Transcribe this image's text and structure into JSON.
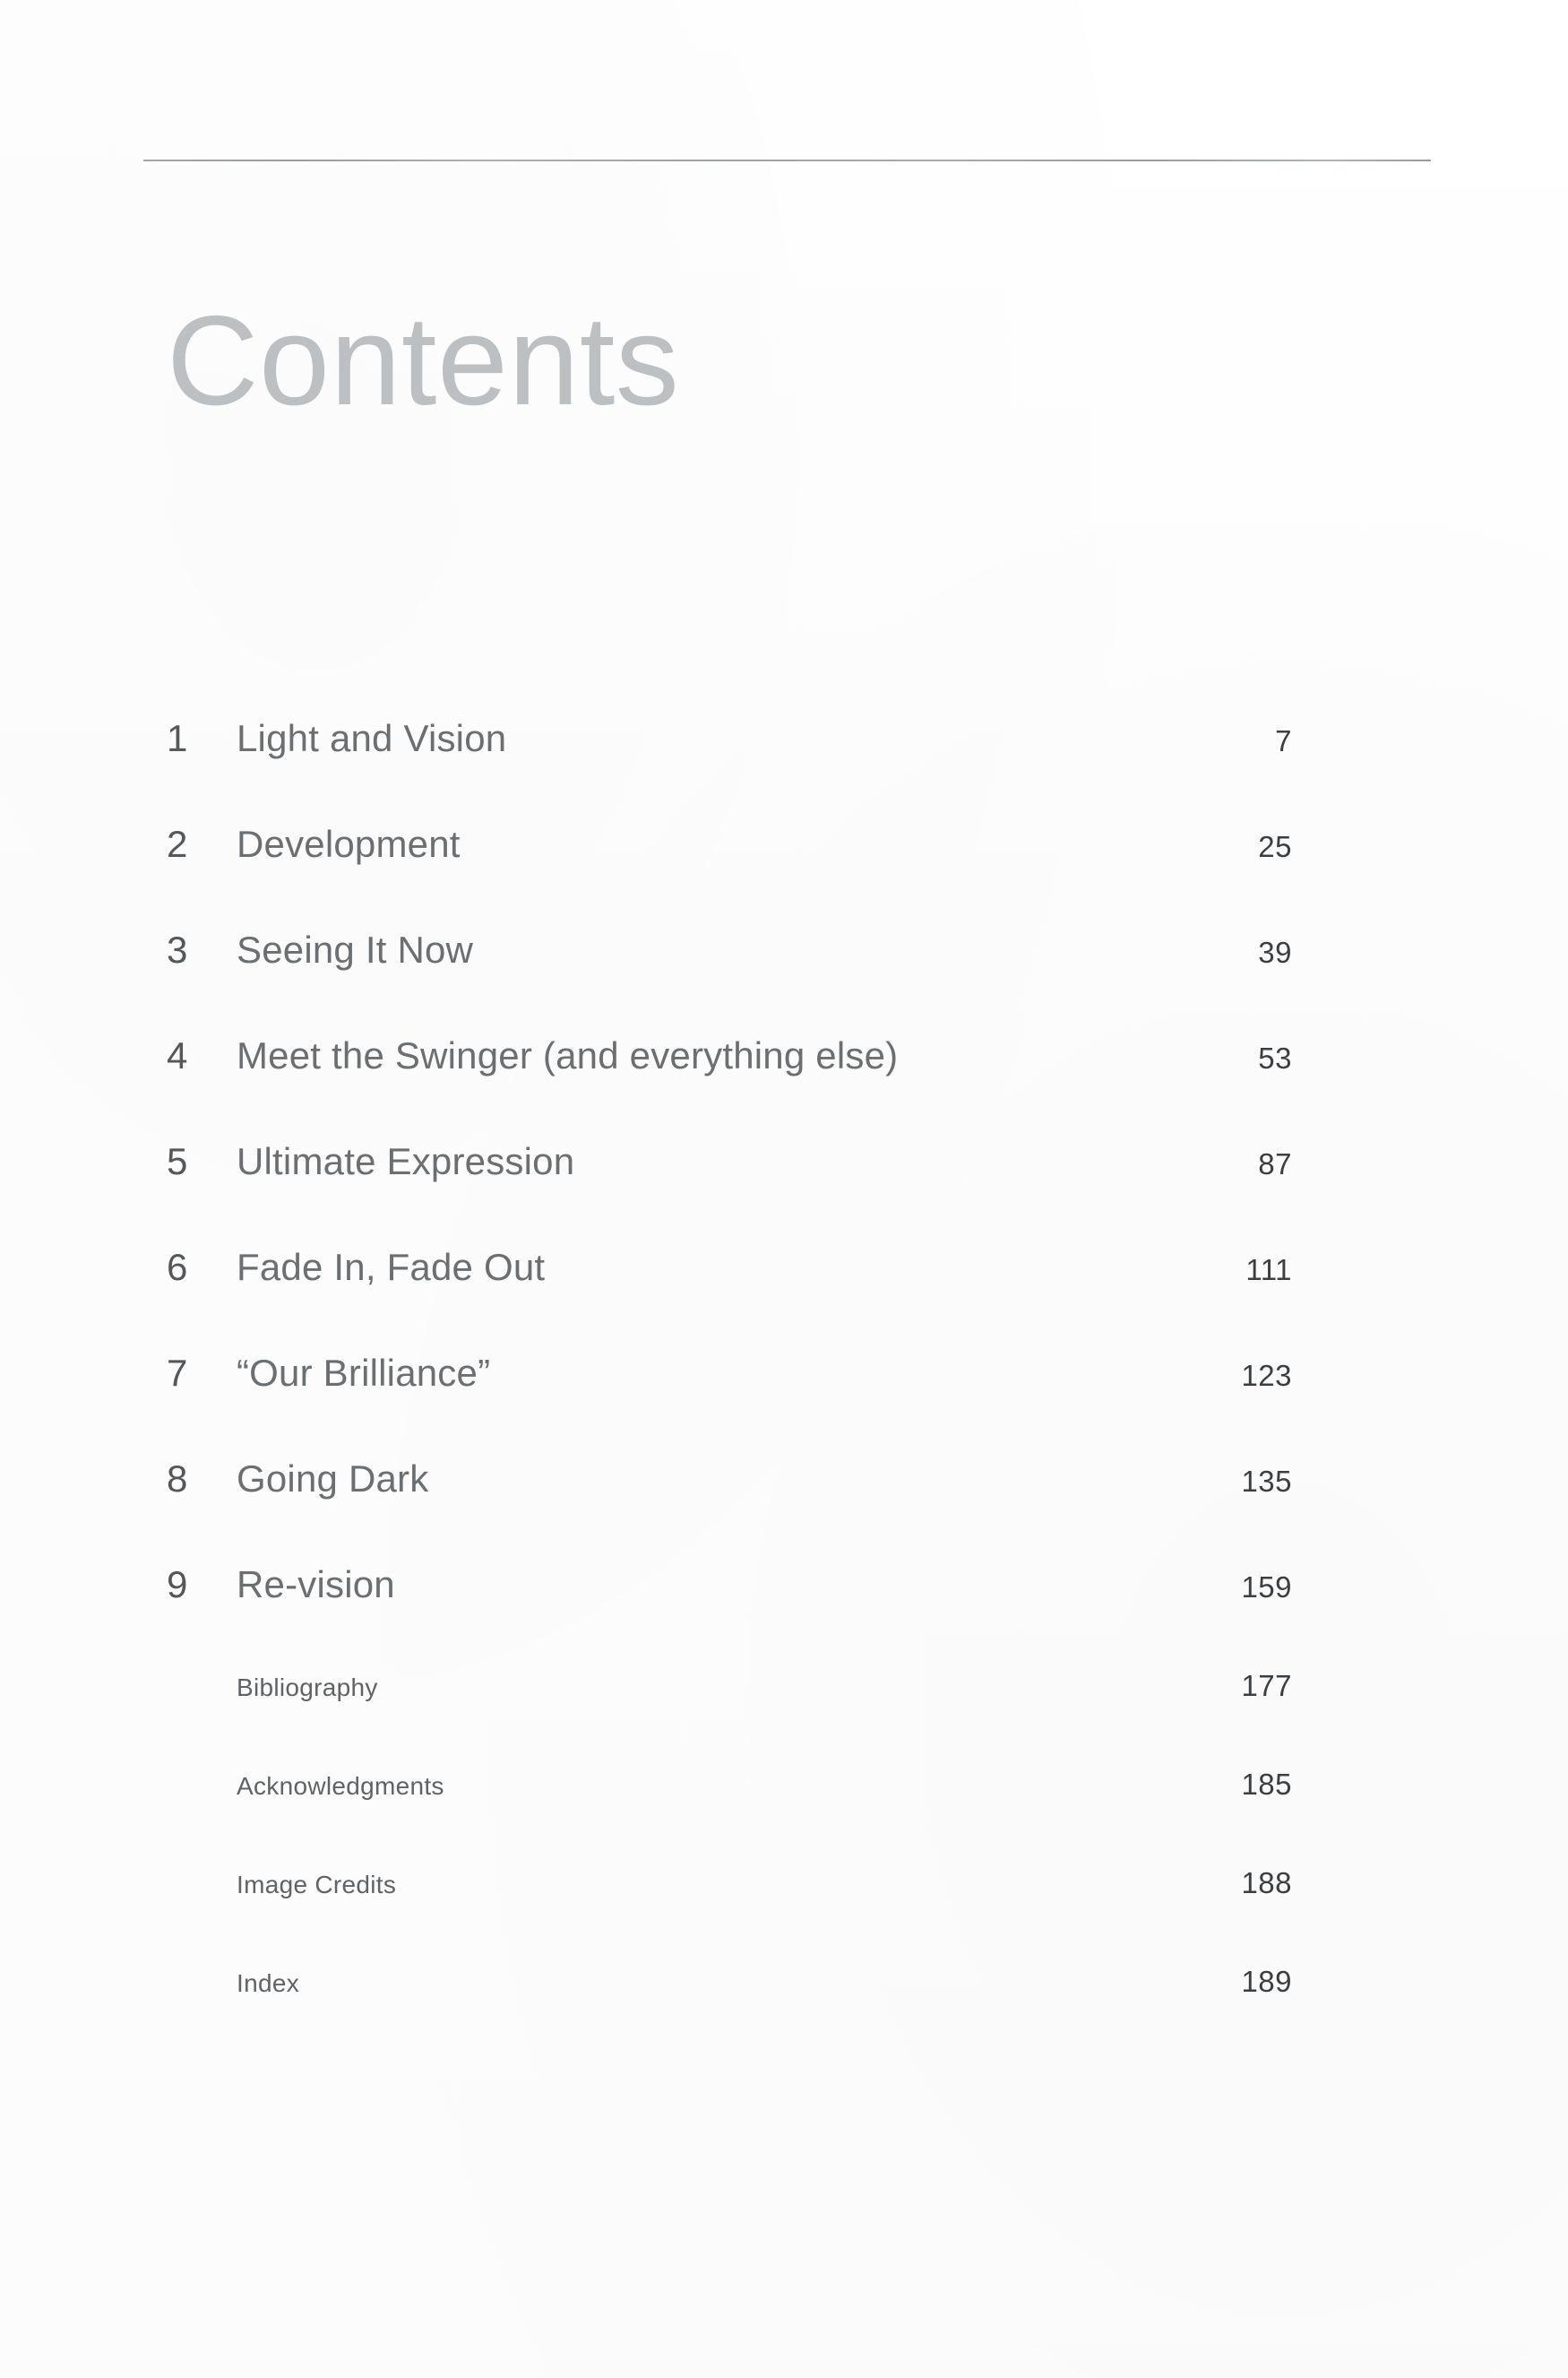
{
  "page": {
    "title": "Contents"
  },
  "divider": "horizontal-rule",
  "toc": {
    "chapters": [
      {
        "number": "1",
        "title": "Light and Vision",
        "page": "7"
      },
      {
        "number": "2",
        "title": "Development",
        "page": "25"
      },
      {
        "number": "3",
        "title": "Seeing It Now",
        "page": "39"
      },
      {
        "number": "4",
        "title": "Meet the Swinger (and everything else)",
        "page": "53"
      },
      {
        "number": "5",
        "title": "Ultimate Expression",
        "page": "87"
      },
      {
        "number": "6",
        "title": "Fade In, Fade Out",
        "page": "111"
      },
      {
        "number": "7",
        "title": "“Our Brilliance”",
        "page": "123"
      },
      {
        "number": "8",
        "title": "Going Dark",
        "page": "135"
      },
      {
        "number": "9",
        "title": "Re-vision",
        "page": "159"
      }
    ],
    "back_matter": [
      {
        "number": "",
        "title": "Bibliography",
        "page": "177"
      },
      {
        "number": "",
        "title": "Acknowledgments",
        "page": "185"
      },
      {
        "number": "",
        "title": "Image Credits",
        "page": "188"
      },
      {
        "number": "",
        "title": "Index",
        "page": "189"
      }
    ]
  },
  "colors": {
    "page_background": "#fefefe",
    "title_text": "#bcc0c3",
    "chapter_number_text": "#54585b",
    "chapter_title_text": "#6b6f72",
    "page_number_text": "#3b3f42",
    "rule": "#9aa0a4"
  }
}
